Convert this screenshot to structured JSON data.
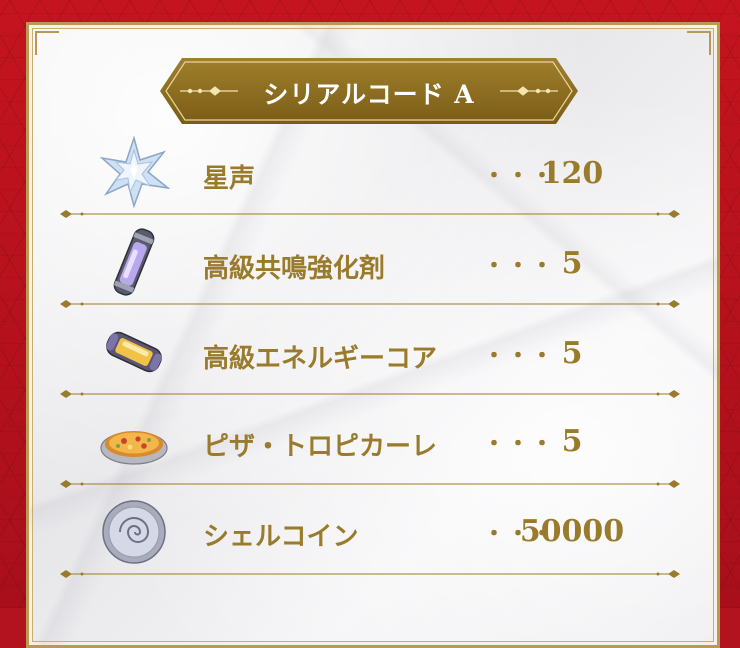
{
  "title": "シリアルコード A",
  "items": [
    {
      "name": "星声",
      "dots": "・・・",
      "qty": "120",
      "icon": "star-crystal-icon"
    },
    {
      "name": "高級共鳴強化剤",
      "dots": "・・・",
      "qty": "5",
      "icon": "capsule-vial-icon"
    },
    {
      "name": "高級エネルギーコア",
      "dots": "・・・",
      "qty": "5",
      "icon": "energy-core-icon"
    },
    {
      "name": "ピザ・トロピカーレ",
      "dots": "・・・",
      "qty": "5",
      "icon": "pizza-icon"
    },
    {
      "name": "シェルコイン",
      "dots": "・・・",
      "qty": "50000",
      "icon": "shell-coin-icon"
    }
  ],
  "colors": {
    "background": "#b3121f",
    "gold": "#9a7b2c",
    "banner": "#8a6a1e",
    "panel": "#eeeef0"
  }
}
